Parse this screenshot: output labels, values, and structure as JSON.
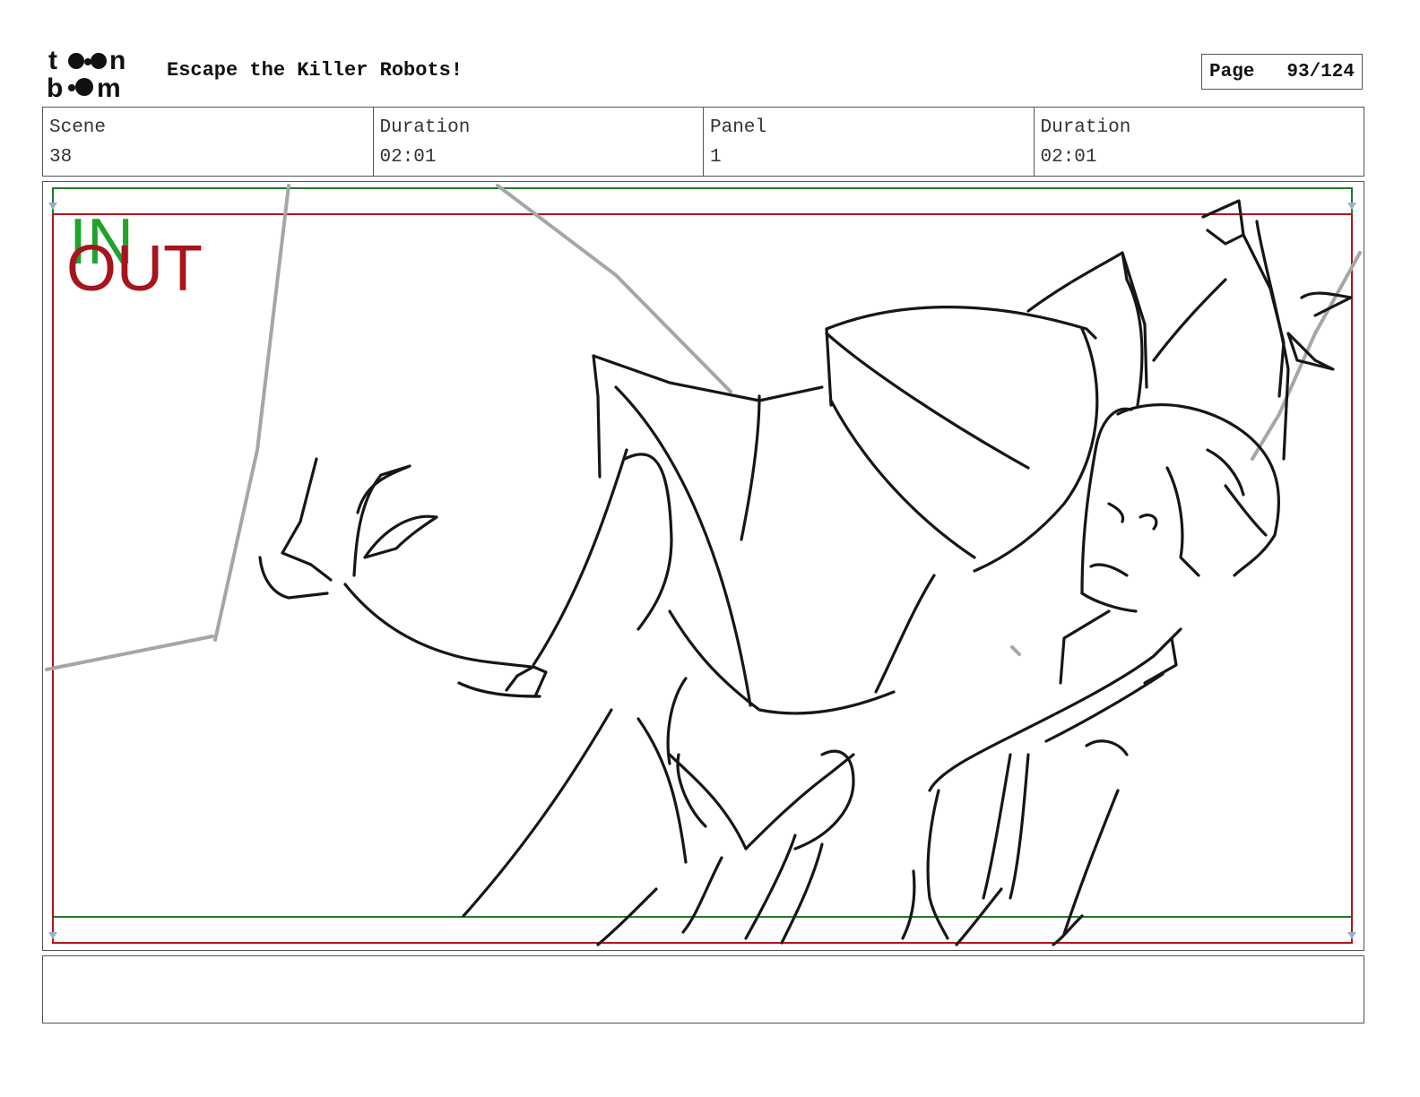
{
  "header": {
    "logo_text": "toon boom",
    "project_title": "Escape the Killer Robots!",
    "page_label": "Page",
    "page_value": "93/124"
  },
  "info": {
    "scene_label": "Scene",
    "scene_value": "38",
    "scene_duration_label": "Duration",
    "scene_duration_value": "02:01",
    "panel_label": "Panel",
    "panel_value": "1",
    "panel_duration_label": "Duration",
    "panel_duration_value": "02:01"
  },
  "panel": {
    "in_label": "IN",
    "out_label": "OUT",
    "safe_frame_color": "#1e7a2a",
    "camera_frame_color": "#b3141c"
  },
  "notes": {
    "dialogue": ""
  }
}
